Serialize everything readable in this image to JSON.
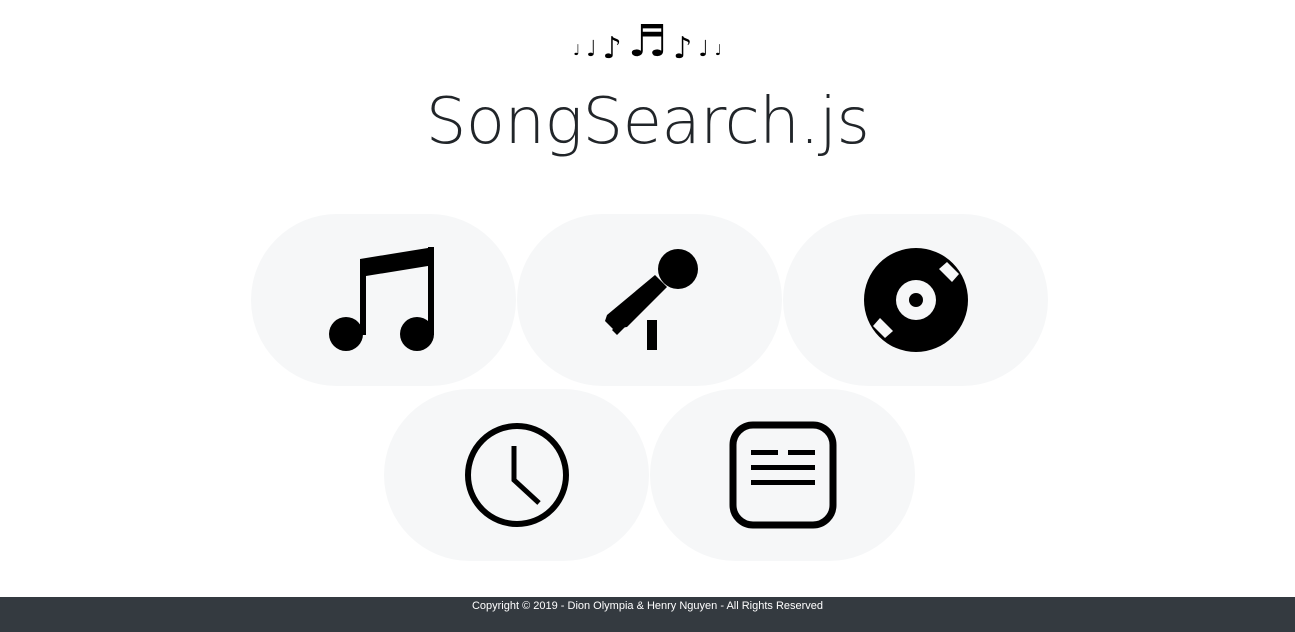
{
  "header": {
    "notes": [
      "♩",
      "♩",
      "♪",
      "♬",
      "♪",
      "♩",
      "♩"
    ],
    "title_main": "SongSearch",
    "title_ext": ".js"
  },
  "tiles": [
    {
      "icon": "music-notes-icon"
    },
    {
      "icon": "microphone-icon"
    },
    {
      "icon": "vinyl-record-icon"
    },
    {
      "icon": "clock-icon"
    },
    {
      "icon": "lyrics-icon"
    }
  ],
  "footer": {
    "text": "Copyright © 2019 - Dion Olympia & Henry Nguyen - All Rights Reserved"
  },
  "colors": {
    "tile_bg": "#f6f7f8",
    "footer_bg": "#343a40",
    "icon": "#000000"
  }
}
